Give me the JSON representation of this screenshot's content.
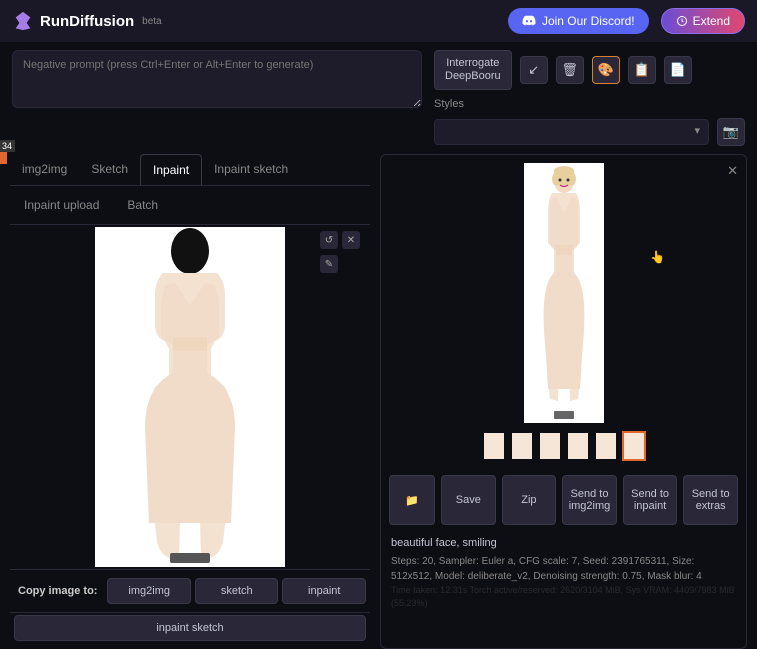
{
  "header": {
    "logo_text": "RunDiffusion",
    "beta": "beta",
    "discord": "Join Our Discord!",
    "extend": "Extend"
  },
  "neg_placeholder": "Negative prompt (press Ctrl+Enter or Alt+Enter to generate)",
  "interrogate": {
    "line1": "Interrogate",
    "line2": "DeepBooru"
  },
  "styles_label": "Styles",
  "tabs": [
    "img2img",
    "Sketch",
    "Inpaint",
    "Inpaint sketch"
  ],
  "subtabs": [
    "Inpaint upload",
    "Batch"
  ],
  "badge_num": "34",
  "copy_label": "Copy image to:",
  "copy_btns": [
    "img2img",
    "sketch",
    "inpaint"
  ],
  "copy_btn2": "inpaint sketch",
  "actions": {
    "save": "Save",
    "zip": "Zip",
    "send_img2img": "Send to img2img",
    "send_inpaint": "Send to inpaint",
    "send_extras": "Send to extras"
  },
  "gen": {
    "prompt": "beautiful face, smiling",
    "params": "Steps: 20, Sampler: Euler a, CFG scale: 7, Seed: 2391765311, Size: 512x512, Model: deliberate_v2, Denoising strength: 0.75, Mask blur: 4",
    "timing": "Time taken: 12.31s   Torch active/reserved: 2620/3104 MiB, Sys VRAM: 4409/7983 MiB (55.23%)"
  }
}
